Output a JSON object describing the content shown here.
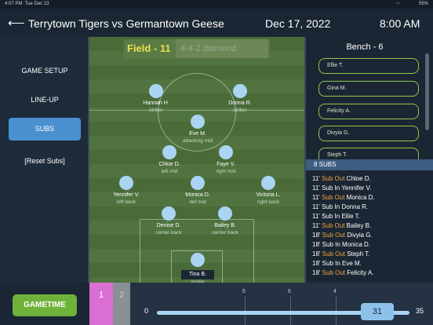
{
  "status": {
    "time": "4:07 PM",
    "date": "Tue Dec 13",
    "battery": "55%",
    "wifi": "wifi-icon"
  },
  "header": {
    "back_icon": "arrow-left-icon",
    "title": "Terrytown Tigers vs Germantown Geese",
    "date": "Dec 17, 2022",
    "time": "8:00 AM"
  },
  "sidebar": {
    "items": [
      {
        "label": "GAME SETUP"
      },
      {
        "label": "LINE-UP"
      },
      {
        "label": "SUBS"
      },
      {
        "label": "[Reset Subs]"
      }
    ]
  },
  "field": {
    "title": "Field - 11",
    "formation": "4-4-2 diamond",
    "players": [
      {
        "name": "Hannah H.",
        "pos": "striker"
      },
      {
        "name": "Donna R.",
        "pos": "striker"
      },
      {
        "name": "Eve M.",
        "pos": "attacking mid"
      },
      {
        "name": "Chloe D.",
        "pos": "left mid"
      },
      {
        "name": "Faye V.",
        "pos": "right mid"
      },
      {
        "name": "Yennifer V.",
        "pos": "left back"
      },
      {
        "name": "Monica D.",
        "pos": "def mid"
      },
      {
        "name": "Victoria L.",
        "pos": "right back"
      },
      {
        "name": "Denise D.",
        "pos": "center back"
      },
      {
        "name": "Bailey B.",
        "pos": "center back"
      },
      {
        "name": "Tina B.",
        "pos": "goalie"
      }
    ]
  },
  "bench": {
    "title": "Bench - 6",
    "items": [
      {
        "name": "Ellie T."
      },
      {
        "name": "Gina M."
      },
      {
        "name": "Felicity A."
      },
      {
        "name": "Divyia G."
      },
      {
        "name": "Steph T."
      }
    ]
  },
  "subs": {
    "header": "8 SUBS",
    "rows": [
      {
        "min": "11'",
        "type": "Sub Out",
        "name": "Chloe D."
      },
      {
        "min": "11'",
        "type": "Sub In",
        "name": "Yennifer V."
      },
      {
        "min": "11'",
        "type": "Sub Out",
        "name": "Monica D."
      },
      {
        "min": "11'",
        "type": "Sub In",
        "name": "Donna R."
      },
      {
        "min": "11'",
        "type": "Sub In",
        "name": "Ellie T."
      },
      {
        "min": "11'",
        "type": "Sub Out",
        "name": "Bailey B."
      },
      {
        "min": "18'",
        "type": "Sub Out",
        "name": "Divyia G."
      },
      {
        "min": "18'",
        "type": "Sub In",
        "name": "Monica D."
      },
      {
        "min": "18'",
        "type": "Sub Out",
        "name": "Steph T."
      },
      {
        "min": "18'",
        "type": "Sub In",
        "name": "Eve M."
      },
      {
        "min": "18'",
        "type": "Sub Out",
        "name": "Felicity A."
      }
    ]
  },
  "footer": {
    "gametime_label": "GAMETIME",
    "half1": "1",
    "half2": "2",
    "ticks": [
      "6",
      "6",
      "4"
    ],
    "min": "0",
    "max": "35",
    "value": "31"
  },
  "colors": {
    "accent": "#4a90cf",
    "gametime": "#6fb23a",
    "sub_out": "#f0a63a",
    "bench_border": "#8fc74a",
    "half1": "#d96ed3"
  }
}
